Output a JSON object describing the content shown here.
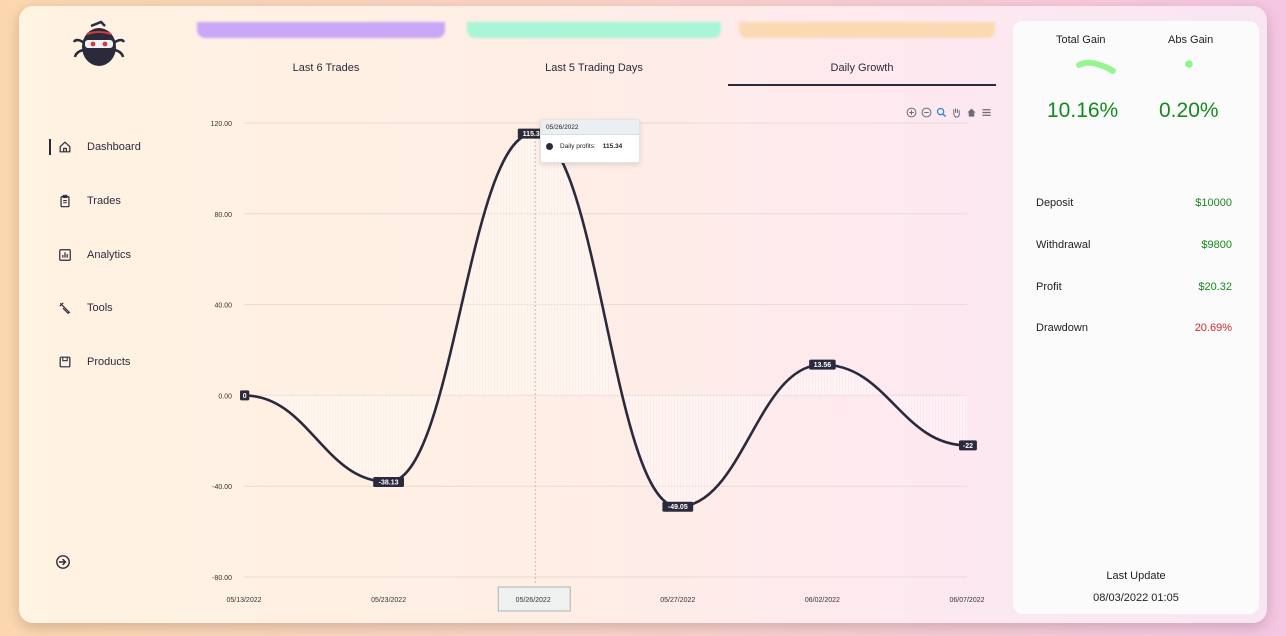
{
  "sidebar": {
    "items": [
      {
        "label": "Dashboard",
        "icon": "home-icon",
        "active": true
      },
      {
        "label": "Trades",
        "icon": "clipboard-icon",
        "active": false
      },
      {
        "label": "Analytics",
        "icon": "bar-chart-icon",
        "active": false
      },
      {
        "label": "Tools",
        "icon": "wrench-icon",
        "active": false
      },
      {
        "label": "Products",
        "icon": "box-icon",
        "active": false
      }
    ],
    "logout_icon": "logout-icon"
  },
  "tabs": [
    {
      "label": "Last 6 Trades",
      "active": false
    },
    {
      "label": "Last 5 Trading Days",
      "active": false
    },
    {
      "label": "Daily Growth",
      "active": true
    }
  ],
  "chart_data": {
    "type": "line",
    "categories": [
      "05/13/2022",
      "05/23/2022",
      "05/26/2022",
      "05/27/2022",
      "06/02/2022",
      "06/07/2022"
    ],
    "series": [
      {
        "name": "Daily profits",
        "values": [
          0,
          -38.13,
          115.34,
          -49.05,
          13.56,
          -22
        ]
      }
    ],
    "data_labels": [
      "0",
      "-38.13",
      "115.34",
      "-49.05",
      "13.56",
      "-22"
    ],
    "y_ticks": [
      "120.00",
      "80.00",
      "40.00",
      "0.00",
      "-40.00",
      "-80.00"
    ],
    "ylim": [
      -80,
      120
    ],
    "grid": true,
    "line_color": "#2a2a3c",
    "highlighted_category": "05/26/2022",
    "tooltip": {
      "date": "05/26/2022",
      "series": "Daily profits:",
      "value": "115.34"
    }
  },
  "toolbar_icons": [
    "zoom-in-icon",
    "zoom-out-icon",
    "magnifier-icon",
    "pan-hand-icon",
    "reset-home-icon",
    "menu-icon"
  ],
  "summary": {
    "total_gain_label": "Total Gain",
    "total_gain_value": "10.16%",
    "abs_gain_label": "Abs Gain",
    "abs_gain_value": "0.20%",
    "stats": [
      {
        "label": "Deposit",
        "value": "$10000",
        "tone": "pos"
      },
      {
        "label": "Withdrawal",
        "value": "$9800",
        "tone": "pos"
      },
      {
        "label": "Profit",
        "value": "$20.32",
        "tone": "pos"
      },
      {
        "label": "Drawdown",
        "value": "20.69%",
        "tone": "neg"
      }
    ],
    "last_update_label": "Last Update",
    "last_update_value": "08/03/2022 01:05"
  },
  "colors": {
    "positive": "#138a1e",
    "negative": "#d12a2a",
    "accent": "#2a2a3c",
    "sparkline": "#8ef58a"
  }
}
